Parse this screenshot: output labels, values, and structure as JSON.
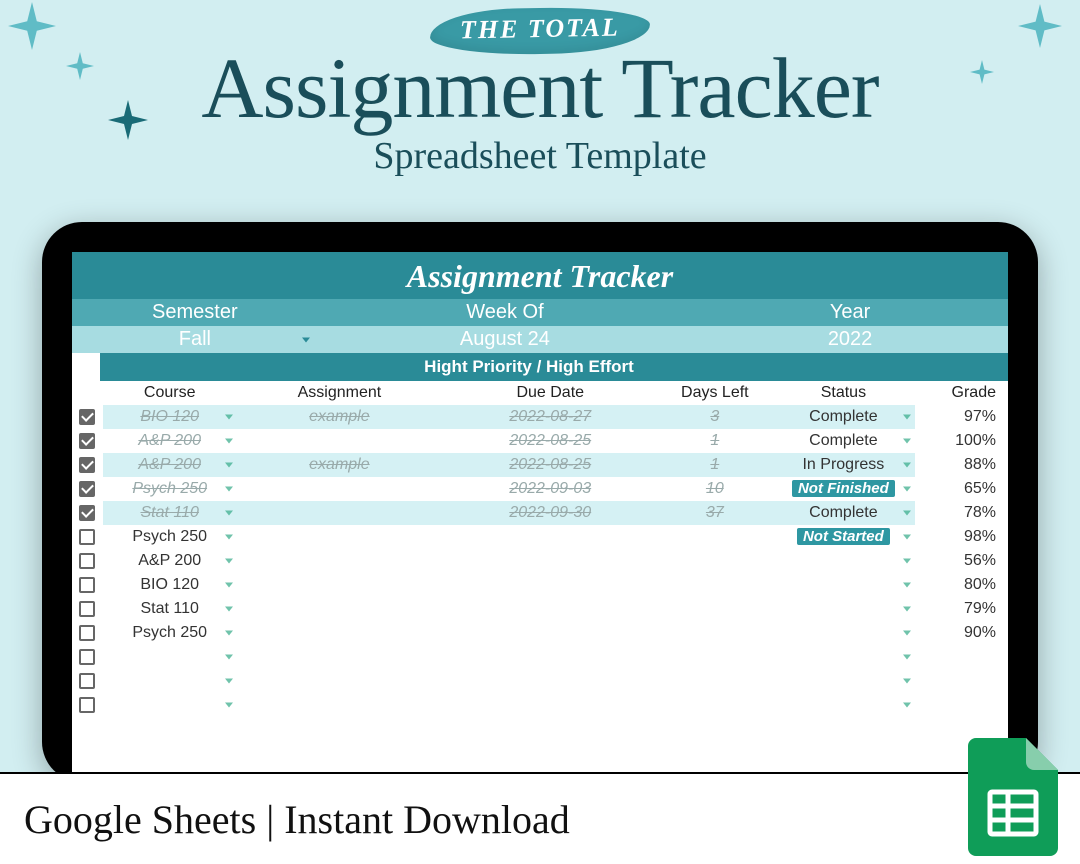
{
  "hero": {
    "eyebrow": "THE TOTAL",
    "main": "Assignment Tracker",
    "sub": "Spreadsheet Template"
  },
  "sheet": {
    "title": "Assignment Tracker",
    "meta_headers": {
      "semester": "Semester",
      "week": "Week Of",
      "year": "Year"
    },
    "meta_values": {
      "semester": "Fall",
      "week": "August 24",
      "year": "2022"
    },
    "priority_label": "Hight Priority / High Effort",
    "columns": [
      "",
      "Course",
      "Assignment",
      "Due Date",
      "Days Left",
      "Status",
      "Grade"
    ],
    "rows": [
      {
        "checked": true,
        "shade": true,
        "strike": true,
        "course": "BIO 120",
        "assignment": "example",
        "due": "2022-08-27",
        "days": "3",
        "status": "Complete",
        "status_style": "plain",
        "grade": "97%"
      },
      {
        "checked": true,
        "shade": false,
        "strike": true,
        "course": "A&P 200",
        "assignment": "",
        "due": "2022-08-25",
        "days": "1",
        "status": "Complete",
        "status_style": "plain",
        "grade": "100%"
      },
      {
        "checked": true,
        "shade": true,
        "strike": true,
        "course": "A&P 200",
        "assignment": "example",
        "due": "2022-08-25",
        "days": "1",
        "status": "In Progress",
        "status_style": "plain",
        "grade": "88%"
      },
      {
        "checked": true,
        "shade": false,
        "strike": true,
        "course": "Psych 250",
        "assignment": "",
        "due": "2022-09-03",
        "days": "10",
        "status": "Not Finished",
        "status_style": "notfin",
        "grade": "65%"
      },
      {
        "checked": true,
        "shade": true,
        "strike": true,
        "course": "Stat 110",
        "assignment": "",
        "due": "2022-09-30",
        "days": "37",
        "status": "Complete",
        "status_style": "plain",
        "grade": "78%"
      },
      {
        "checked": false,
        "shade": false,
        "strike": false,
        "course": "Psych 250",
        "assignment": "",
        "due": "",
        "days": "",
        "status": "Not Started",
        "status_style": "notstart",
        "grade": "98%"
      },
      {
        "checked": false,
        "shade": false,
        "strike": false,
        "course": "A&P 200",
        "assignment": "",
        "due": "",
        "days": "",
        "status": "",
        "status_style": "",
        "grade": "56%"
      },
      {
        "checked": false,
        "shade": false,
        "strike": false,
        "course": "BIO 120",
        "assignment": "",
        "due": "",
        "days": "",
        "status": "",
        "status_style": "",
        "grade": "80%"
      },
      {
        "checked": false,
        "shade": false,
        "strike": false,
        "course": "Stat 110",
        "assignment": "",
        "due": "",
        "days": "",
        "status": "",
        "status_style": "",
        "grade": "79%"
      },
      {
        "checked": false,
        "shade": false,
        "strike": false,
        "course": "Psych 250",
        "assignment": "",
        "due": "",
        "days": "",
        "status": "",
        "status_style": "",
        "grade": "90%"
      },
      {
        "checked": false,
        "shade": false,
        "strike": false,
        "course": "",
        "assignment": "",
        "due": "",
        "days": "",
        "status": "",
        "status_style": "",
        "grade": ""
      },
      {
        "checked": false,
        "shade": false,
        "strike": false,
        "course": "",
        "assignment": "",
        "due": "",
        "days": "",
        "status": "",
        "status_style": "",
        "grade": ""
      },
      {
        "checked": false,
        "shade": false,
        "strike": false,
        "course": "",
        "assignment": "",
        "due": "",
        "days": "",
        "status": "",
        "status_style": "",
        "grade": ""
      }
    ]
  },
  "footer": {
    "text": "Google Sheets | Instant Download"
  }
}
